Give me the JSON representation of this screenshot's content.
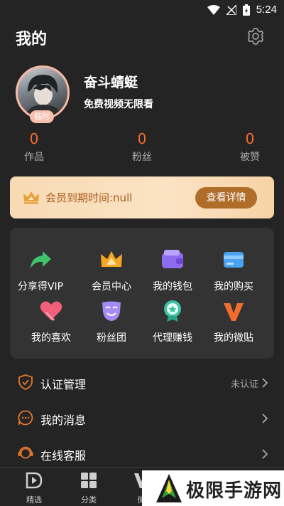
{
  "status_bar": {
    "time": "5:24"
  },
  "header": {
    "title": "我的"
  },
  "profile": {
    "avatar_badge": "临时",
    "username": "奋斗蜻蜓",
    "subtitle": "免费视频无限看"
  },
  "stats": [
    {
      "value": "0",
      "label": "作品"
    },
    {
      "value": "0",
      "label": "粉丝"
    },
    {
      "value": "0",
      "label": "被赞"
    }
  ],
  "vip": {
    "text": "会员到期时间:null",
    "button": "查看详情"
  },
  "grid": [
    {
      "label": "分享得VIP",
      "icon": "share-arrow-icon"
    },
    {
      "label": "会员中心",
      "icon": "crown-icon"
    },
    {
      "label": "我的钱包",
      "icon": "wallet-icon"
    },
    {
      "label": "我的购买",
      "icon": "card-icon"
    },
    {
      "label": "我的喜欢",
      "icon": "heart-icon"
    },
    {
      "label": "粉丝团",
      "icon": "mask-icon"
    },
    {
      "label": "代理赚钱",
      "icon": "medal-icon"
    },
    {
      "label": "我的微贴",
      "icon": "v-logo-icon"
    }
  ],
  "menu": [
    {
      "label": "认证管理",
      "value": "未认证",
      "icon": "shield-icon"
    },
    {
      "label": "我的消息",
      "value": "",
      "icon": "message-icon"
    },
    {
      "label": "在线客服",
      "value": "",
      "icon": "headset-icon"
    }
  ],
  "bottom_nav": [
    {
      "label": "精选",
      "icon": "play-icon"
    },
    {
      "label": "分类",
      "icon": "category-icon"
    },
    {
      "label": "微",
      "icon": "v-icon"
    }
  ],
  "watermark": {
    "text": "极限手游网"
  },
  "colors": {
    "background": "#242424",
    "accent": "#f26d2b",
    "card": "#333333",
    "vip_button": "#b06d2a"
  }
}
